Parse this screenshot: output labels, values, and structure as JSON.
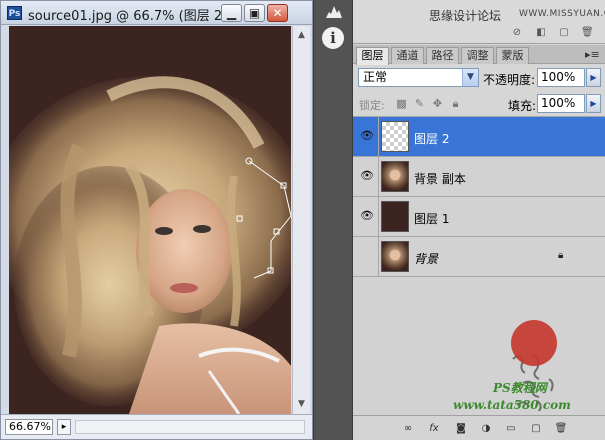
{
  "doc_window": {
    "app_icon": "Ps",
    "title": "source01.jpg @ 66.7% (图层 2...",
    "zoom": "66.67%"
  },
  "top_panel": {
    "forum_text": "思缘设计论坛",
    "forum_url": "WWW.MISSYUAN.COM"
  },
  "tabs": [
    "图层",
    "通道",
    "路径",
    "调整",
    "蒙版"
  ],
  "layers_panel": {
    "blend_mode": "正常",
    "opacity_label": "不透明度:",
    "opacity_value": "100%",
    "lock_label": "锁定:",
    "fill_label": "填充:",
    "fill_value": "100%",
    "layers": [
      {
        "name": "图层 2",
        "visible": true,
        "selected": true,
        "thumb": "transparent"
      },
      {
        "name": "背景 副本",
        "visible": true,
        "selected": false,
        "thumb": "photo"
      },
      {
        "name": "图层 1",
        "visible": true,
        "selected": false,
        "thumb": "dark"
      },
      {
        "name": "背景",
        "visible": false,
        "selected": false,
        "thumb": "photo",
        "locked": true
      }
    ]
  },
  "watermark": {
    "ps_course": "PS教程网",
    "site": "www.tata580.com"
  },
  "colors": {
    "selection": "#3875d7",
    "canvas_bg": "#3c2420"
  }
}
